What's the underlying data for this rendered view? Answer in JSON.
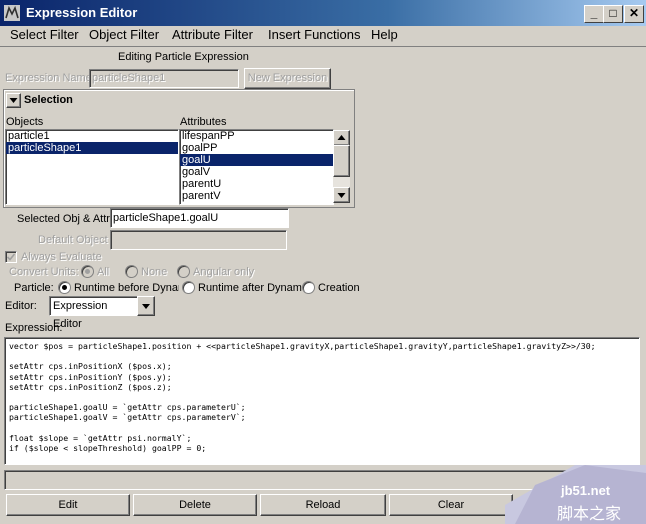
{
  "window": {
    "title": "Expression Editor",
    "minimize_glyph": "_",
    "maximize_glyph": "□",
    "close_glyph": "✕"
  },
  "menu": [
    "Select Filter",
    "Object Filter",
    "Attribute Filter",
    "Insert Functions",
    "Help"
  ],
  "header": {
    "mode_label": "Editing Particle Expression"
  },
  "expression_name": {
    "label": "Expression Name",
    "value": "particleShape1",
    "new_button": "New Expression"
  },
  "selection": {
    "title": "Selection",
    "objects_label": "Objects",
    "attributes_label": "Attributes",
    "objects": [
      "particle1",
      "particleShape1"
    ],
    "objects_selected": 1,
    "attributes": [
      "lifespanPP",
      "goalPP",
      "goalU",
      "goalV",
      "parentU",
      "parentV"
    ],
    "attributes_selected": 2
  },
  "selected_obj_attr": {
    "label": "Selected Obj & Attr",
    "value": "particleShape1.goalU"
  },
  "default_object": {
    "label": "Default Object",
    "value": ""
  },
  "always_evaluate": {
    "label": "Always Evaluate",
    "checked": true
  },
  "convert_units": {
    "label": "Convert Units:",
    "options": [
      "All",
      "None",
      "Angular only"
    ],
    "selected": "All"
  },
  "particle": {
    "label": "Particle:",
    "options": [
      "Runtime before Dynami",
      "Runtime after Dynamic",
      "Creation"
    ],
    "selected": 0
  },
  "editor": {
    "label": "Editor:",
    "value": "Expression Editor"
  },
  "expression": {
    "label": "Expression:",
    "lines": [
      "vector $pos = particleShape1.position + <<particleShape1.gravityX,particleShape1.gravityY,particleShape1.gravityZ>>/30;",
      "",
      "setAttr cps.inPositionX ($pos.x);",
      "setAttr cps.inPositionY ($pos.y);",
      "setAttr cps.inPositionZ ($pos.z);",
      "",
      "particleShape1.goalU = `getAttr cps.parameterU`;",
      "particleShape1.goalV = `getAttr cps.parameterV`;",
      "",
      "float $slope = `getAttr psi.normalY`;",
      "if ($slope < slopeThreshold) goalPP = 0;"
    ]
  },
  "buttons": {
    "edit": "Edit",
    "delete": "Delete",
    "reload": "Reload",
    "clear": "Clear"
  },
  "watermark": {
    "site": "jb51.net",
    "name": "脚本之家"
  }
}
